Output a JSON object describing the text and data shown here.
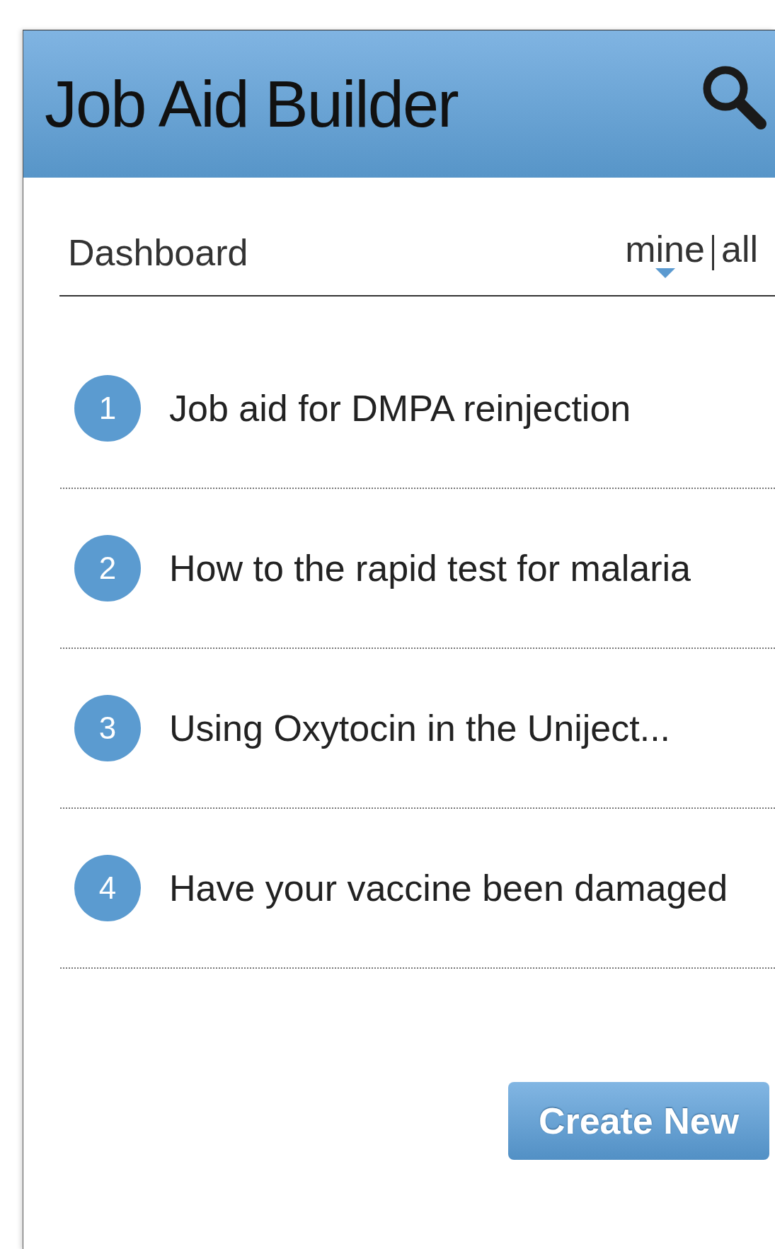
{
  "header": {
    "title": "Job Aid Builder"
  },
  "dashboard": {
    "title": "Dashboard",
    "filters": [
      {
        "label": "mine",
        "selected": true
      },
      {
        "label": "all",
        "selected": false
      }
    ]
  },
  "job_aids": [
    {
      "number": "1",
      "title": "Job aid for DMPA reinjection"
    },
    {
      "number": "2",
      "title": "How to the rapid test for malaria"
    },
    {
      "number": "3",
      "title": "Using Oxytocin in the Uniject..."
    },
    {
      "number": "4",
      "title": "Have your vaccine been damaged"
    }
  ],
  "create_button": "Create New"
}
